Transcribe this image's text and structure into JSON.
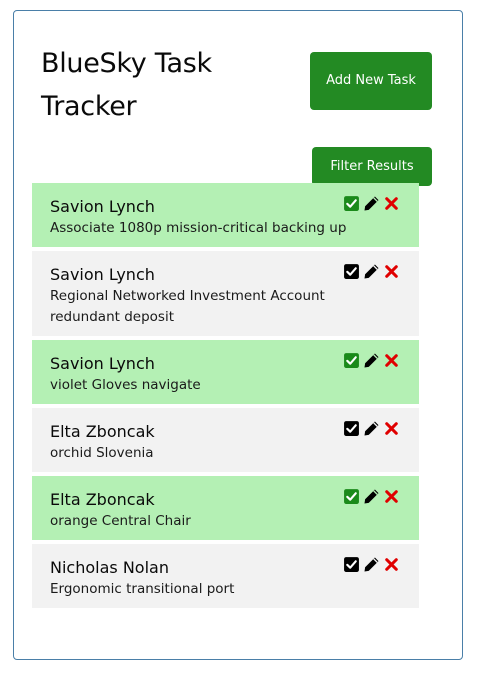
{
  "app": {
    "title": "BlueSky Task Tracker",
    "add_button_label": "Add New Task",
    "filter_button_label": "Filter Results"
  },
  "colors": {
    "accent": "#238a23",
    "done_row": "#b4f0b4",
    "open_row": "#f2f2f2",
    "delete": "#e00000",
    "check_done": "#1a8a1a",
    "check_open": "#000000"
  },
  "tasks": [
    {
      "name": "Savion Lynch",
      "description": "Associate 1080p mission-critical backing up",
      "completed": true
    },
    {
      "name": "Savion Lynch",
      "description": "Regional Networked Investment Account redundant deposit",
      "completed": false
    },
    {
      "name": "Savion Lynch",
      "description": "violet Gloves navigate",
      "completed": true
    },
    {
      "name": "Elta Zboncak",
      "description": "orchid Slovenia",
      "completed": false
    },
    {
      "name": "Elta Zboncak",
      "description": "orange Central Chair",
      "completed": true
    },
    {
      "name": "Nicholas Nolan",
      "description": "Ergonomic transitional port",
      "completed": false
    }
  ],
  "icons": {
    "complete": "check-square-icon",
    "edit": "pencil-icon",
    "delete": "x-icon"
  }
}
